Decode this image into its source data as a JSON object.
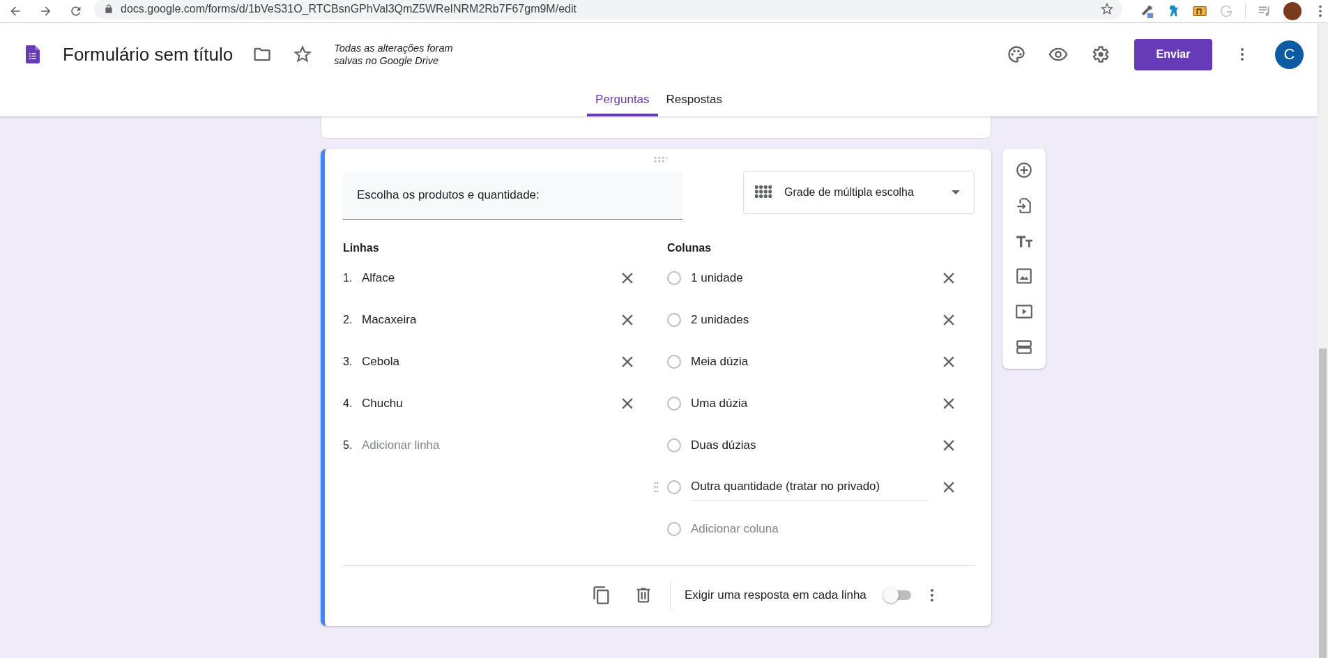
{
  "browser": {
    "url": "docs.google.com/forms/d/1bVeS31O_RTCBsnGPhVal3QmZ5WReINRM2Rb7F67gm9M/edit"
  },
  "header": {
    "title": "Formulário sem título",
    "save_status": "Todas as alterações foram salvas no Google Drive",
    "send_button": "Enviar",
    "avatar_letter": "C"
  },
  "tabs": [
    {
      "label": "Perguntas",
      "selected": true
    },
    {
      "label": "Respostas",
      "selected": false
    }
  ],
  "question": {
    "title": "Escolha os produtos e quantidade:",
    "type": "Grade de múltipla escolha",
    "rows_heading": "Linhas",
    "columns_heading": "Colunas",
    "rows": [
      {
        "number": "1.",
        "label": "Alface"
      },
      {
        "number": "2.",
        "label": "Macaxeira"
      },
      {
        "number": "3.",
        "label": "Cebola"
      },
      {
        "number": "4.",
        "label": "Chuchu"
      }
    ],
    "add_row": {
      "number": "5.",
      "placeholder": "Adicionar linha"
    },
    "columns": [
      {
        "label": "1 unidade",
        "focused": false
      },
      {
        "label": "2 unidades",
        "focused": false
      },
      {
        "label": "Meia dúzia",
        "focused": false
      },
      {
        "label": "Uma dúzia",
        "focused": false
      },
      {
        "label": "Duas dúzias",
        "focused": false
      },
      {
        "label": "Outra quantidade (tratar no privado)",
        "focused": true
      }
    ],
    "add_column": {
      "placeholder": "Adicionar coluna"
    },
    "required_label": "Exigir uma resposta em cada linha",
    "required": false
  }
}
